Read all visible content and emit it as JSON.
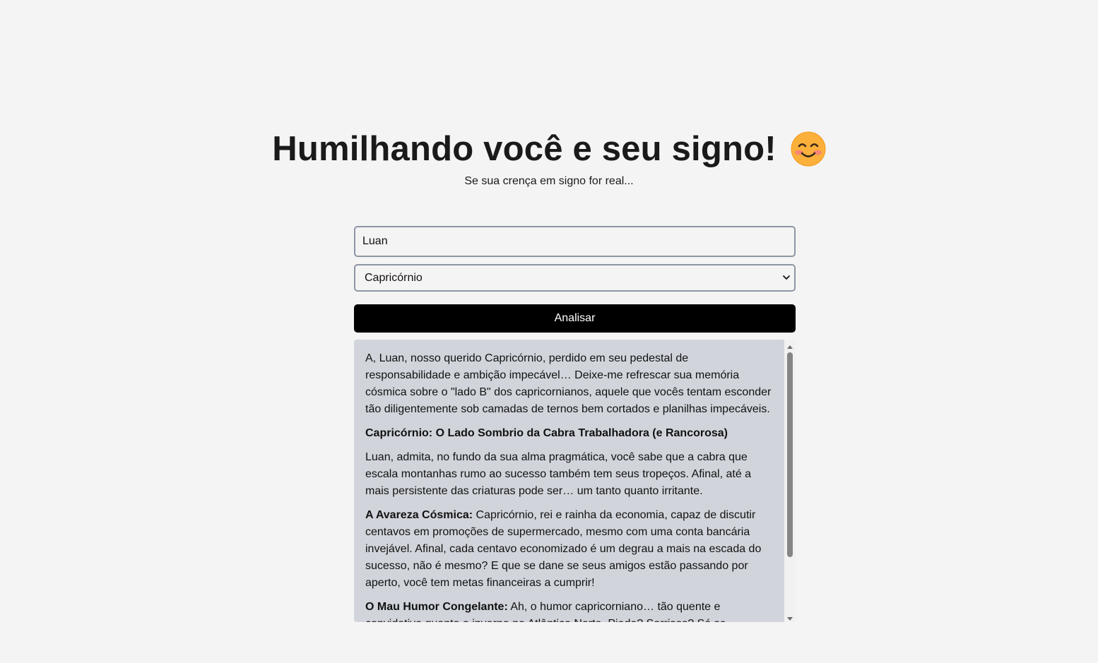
{
  "header": {
    "title": "Humilhando você e seu signo!",
    "emoji_icon": "smiling-face-with-blush-icon",
    "subtitle": "Se sua crença em signo for real..."
  },
  "form": {
    "name_value": "Luan",
    "sign_selected": "Capricórnio",
    "button_label": "Analisar"
  },
  "result": {
    "p1": "A, Luan, nosso querido Capricórnio, perdido em seu pedestal de responsabilidade e ambição impecável… Deixe-me refrescar sua memória cósmica sobre o \"lado B\" dos capricornianos, aquele que vocês tentam esconder tão diligentemente sob camadas de ternos bem cortados e planilhas impecáveis.",
    "heading": "Capricórnio: O Lado Sombrio da Cabra Trabalhadora (e Rancorosa)",
    "p2": "Luan, admita, no fundo da sua alma pragmática, você sabe que a cabra que escala montanhas rumo ao sucesso também tem seus tropeços. Afinal, até a mais persistente das criaturas pode ser… um tanto quanto irritante.",
    "item1_label": "A Avareza Cósmica:",
    "item1_text": " Capricórnio, rei e rainha da economia, capaz de discutir centavos em promoções de supermercado, mesmo com uma conta bancária invejável. Afinal, cada centavo economizado é um degrau a mais na escada do sucesso, não é mesmo? E que se dane se seus amigos estão passando por aperto, você tem metas financeiras a cumprir!",
    "item2_label": "O Mau Humor Congelante:",
    "item2_text": " Ah, o humor capricorniano… tão quente e convidativo quanto o inverno no Atlântico Norte. Piada? Sorrisos? Só se estiverem no planejamento estratégico."
  },
  "colors": {
    "background": "#f4f4f4",
    "button": "#000000",
    "result_bg": "#d1d5db",
    "input_border": "#8d96a3"
  }
}
